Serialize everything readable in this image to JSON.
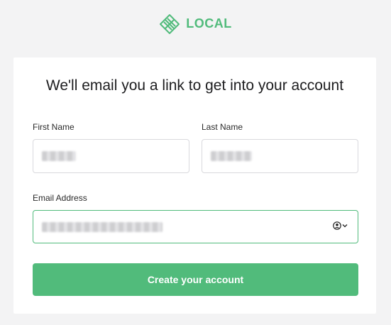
{
  "header": {
    "logo_text": "LOCAL"
  },
  "card": {
    "title": "We'll email you a link to get into your account",
    "first_name": {
      "label": "First Name",
      "value": ""
    },
    "last_name": {
      "label": "Last Name",
      "value": ""
    },
    "email": {
      "label": "Email Address",
      "value": ""
    },
    "submit_label": "Create your account"
  },
  "colors": {
    "accent": "#51bb7b",
    "background": "#f3f3f4",
    "card": "#ffffff"
  },
  "icons": {
    "logo": "local-logo-icon",
    "autofill": "contact-autofill-icon"
  }
}
